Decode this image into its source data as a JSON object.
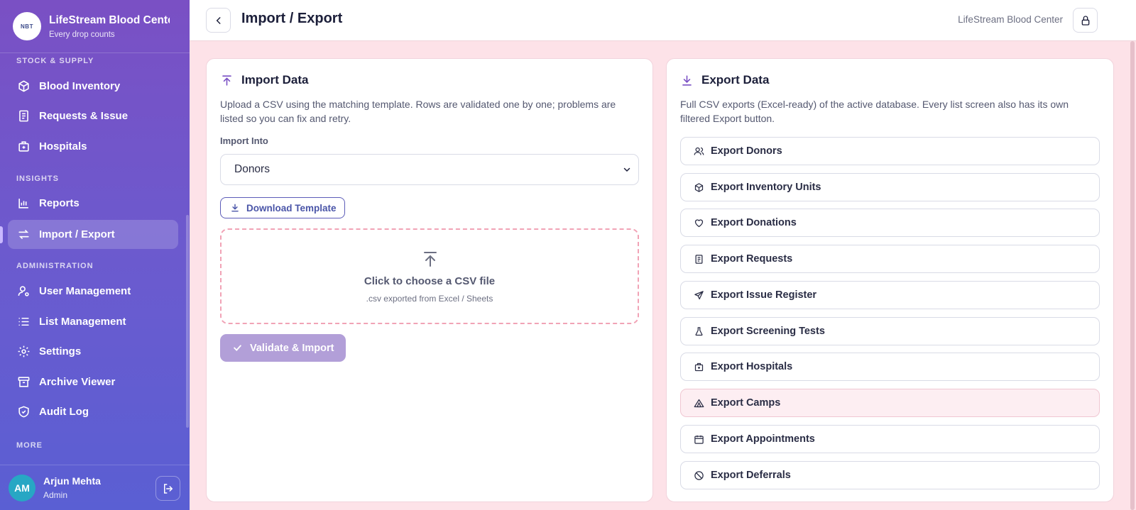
{
  "brand": {
    "logo_text": "NBT",
    "name": "LifeStream Blood Center",
    "tagline": "Every drop counts"
  },
  "sidebar": {
    "sections": [
      {
        "label": "STOCK & SUPPLY"
      },
      {
        "label": "INSIGHTS"
      },
      {
        "label": "ADMINISTRATION"
      },
      {
        "label": "MORE"
      }
    ],
    "items": [
      {
        "label": "Blood Inventory",
        "icon": "box-icon"
      },
      {
        "label": "Requests & Issue",
        "icon": "document-icon"
      },
      {
        "label": "Hospitals",
        "icon": "hospital-icon"
      },
      {
        "label": "Reports",
        "icon": "bar-chart-icon"
      },
      {
        "label": "Import / Export",
        "icon": "swap-arrows-icon",
        "active": true
      },
      {
        "label": "User Management",
        "icon": "user-cog-icon"
      },
      {
        "label": "List Management",
        "icon": "list-icon"
      },
      {
        "label": "Settings",
        "icon": "gear-icon"
      },
      {
        "label": "Archive Viewer",
        "icon": "archive-icon"
      },
      {
        "label": "Audit Log",
        "icon": "shield-check-icon"
      }
    ]
  },
  "user": {
    "initials": "AM",
    "name": "Arjun Mehta",
    "role": "Admin"
  },
  "header": {
    "title": "Import / Export",
    "org": "LifeStream Blood Center"
  },
  "import": {
    "title": "Import Data",
    "description": "Upload a CSV using the matching template. Rows are validated one by one; problems are listed so you can fix and retry.",
    "field_label": "Import Into",
    "selected": "Donors",
    "download_label": "Download Template",
    "dropzone_title": "Click to choose a CSV file",
    "dropzone_sub": ".csv exported from Excel / Sheets",
    "validate_label": "Validate & Import"
  },
  "export": {
    "title": "Export Data",
    "description": "Full CSV exports (Excel-ready) of the active database. Every list screen also has its own filtered Export button.",
    "buttons": [
      {
        "label": "Export Donors",
        "icon": "users-icon"
      },
      {
        "label": "Export Inventory Units",
        "icon": "box-icon"
      },
      {
        "label": "Export Donations",
        "icon": "heart-icon"
      },
      {
        "label": "Export Requests",
        "icon": "document-icon"
      },
      {
        "label": "Export Issue Register",
        "icon": "send-icon"
      },
      {
        "label": "Export Screening Tests",
        "icon": "flask-icon"
      },
      {
        "label": "Export Hospitals",
        "icon": "hospital-icon"
      },
      {
        "label": "Export Camps",
        "icon": "tent-icon"
      },
      {
        "label": "Export Appointments",
        "icon": "calendar-icon"
      },
      {
        "label": "Export Deferrals",
        "icon": "ban-icon"
      }
    ]
  },
  "colors": {
    "sidebar_top": "#7a50c4",
    "sidebar_bottom": "#5a5fd3",
    "page_bg": "#fde2e8",
    "accent": "#4a55a8",
    "validate_disabled": "#b29fd8"
  }
}
